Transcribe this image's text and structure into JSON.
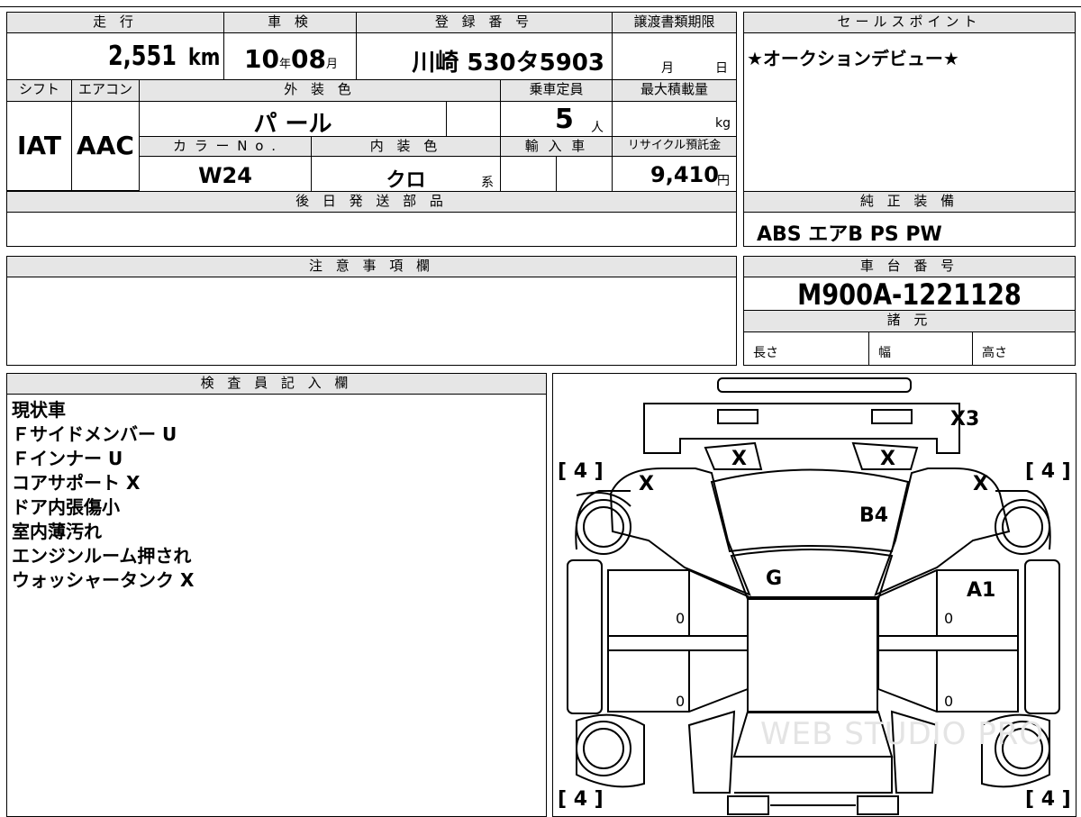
{
  "top_headers": {
    "mileage": "走 行",
    "inspection": "車 検",
    "registration": "登 録 番 号",
    "transfer_deadline": "譲渡書類期限",
    "sales_point": "セールスポイント"
  },
  "values": {
    "mileage": "2,551",
    "mileage_unit": "km",
    "inspection_year": "10",
    "year_unit": "年",
    "inspection_month": "08",
    "month_unit": "月",
    "registration_number": "川崎 530タ5903",
    "deadline_month": "月",
    "deadline_day": "日",
    "sales_point_text": "★オークションデビュー★"
  },
  "row2_headers": {
    "shift": "シフト",
    "aircon": "エアコン",
    "exterior_color": "外 装 色",
    "capacity": "乗車定員",
    "max_load": "最大積載量"
  },
  "row2_values": {
    "shift": "IAT",
    "aircon": "AAC",
    "exterior_color": "パ ール",
    "capacity": "5",
    "capacity_unit": "人",
    "max_load_unit": "kg"
  },
  "row3_headers": {
    "color_no": "カ ラ ー N o .",
    "interior_color": "内 装 色",
    "import_car": "輸 入 車",
    "recycle": "リサイクル預託金"
  },
  "row3_values": {
    "color_no": "W24",
    "interior_color": "クロ",
    "interior_suffix": "系",
    "recycle_amount": "9,410",
    "recycle_unit": "円"
  },
  "later_parts": {
    "header": "後 日 発 送 部 品",
    "value": ""
  },
  "equipment": {
    "header": "純 正 装 備",
    "value": "ABS エアB PS PW"
  },
  "notes": {
    "header": "注 意 事 項 欄",
    "value": ""
  },
  "chassis": {
    "header": "車 台 番 号",
    "value": "M900A-1221128"
  },
  "specs": {
    "header": "諸 元",
    "length": "長さ",
    "width": "幅",
    "height": "高さ"
  },
  "inspector": {
    "header": "検 査 員 記 入 欄",
    "lines": [
      "現状車",
      "Ｆサイドメンバー U",
      "Ｆインナー U",
      "コアサポート X",
      "ドア内張傷小",
      "室内薄汚れ",
      "エンジンルーム押され",
      "ウォッシャータンク X"
    ]
  },
  "diagram": {
    "tire_fl": "[ 4 ]",
    "tire_fr": "[ 4 ]",
    "tire_rl": "[ 4 ]",
    "tire_rr": "[ 4 ]",
    "mark_bumper": "X3",
    "mark_light_left": "X",
    "mark_light_right": "X",
    "mark_fender_left": "X",
    "mark_fender_right": "X",
    "mark_hood": "B4",
    "mark_windshield": "G",
    "mark_door_right": "A1",
    "zero_1": "0",
    "zero_2": "0",
    "zero_3": "0",
    "zero_4": "0",
    "watermark": "WEB STUDIO PRO"
  }
}
